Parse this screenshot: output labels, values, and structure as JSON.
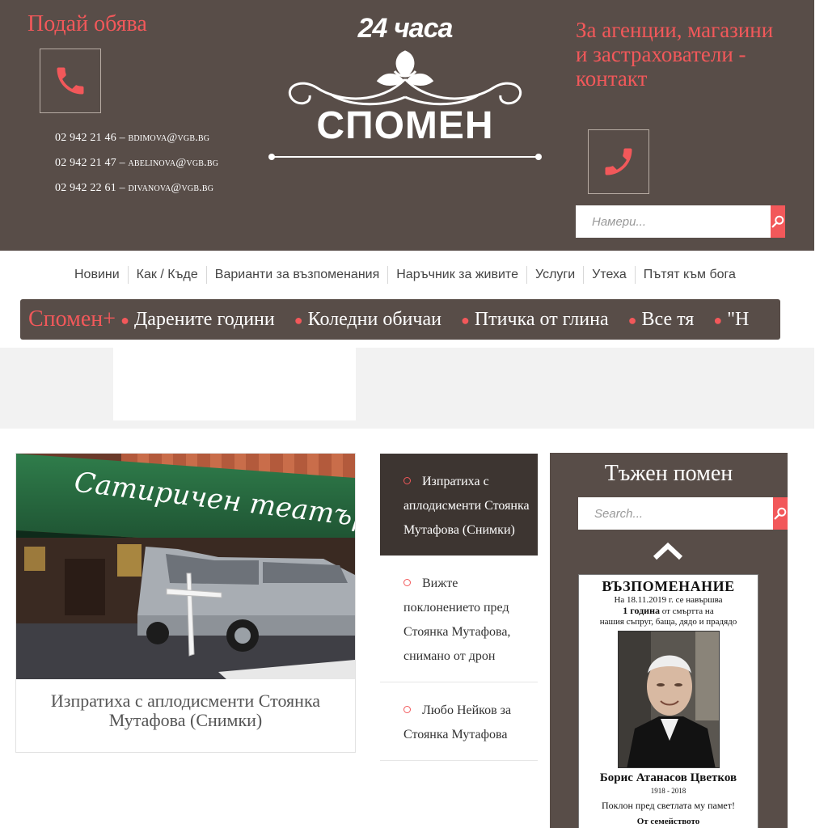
{
  "header": {
    "post_ad": "Подай обява",
    "contacts": [
      {
        "phone": "02 942 21 46",
        "email": "bdimova@vgb.bg"
      },
      {
        "phone": "02 942 21 47",
        "email": "abelinova@vgb.bg"
      },
      {
        "phone": "02 942 22 61",
        "email": "divanova@vgb.bg"
      }
    ],
    "logo_brand": "24 часа",
    "logo_name": "СПОМЕН",
    "agency_contact": "За агенции, магазини и застрахователи - контакт",
    "search_placeholder": "Намери..."
  },
  "nav": {
    "items": [
      "Новини",
      "Как / Къде",
      "Варианти за възпоменания",
      "Наръчник за живите",
      "Услуги",
      "Утеха",
      "Пътят към бога"
    ]
  },
  "ticker": {
    "label": "Спомен+",
    "items": [
      "Дарените години",
      "Коледни обичаи",
      "Птичка от глина",
      "Все тя",
      "\"Н"
    ]
  },
  "main_article": {
    "title": "Изпратиха с аплодисменти Стоянка Мутафова (Снимки)",
    "photo_sign": "Сатиричен театър"
  },
  "news_list": [
    {
      "title": "Изпратиха с аплодисменти Стоянка Мутафова (Снимки)",
      "active": true
    },
    {
      "title": "Вижте поклонението пред Стоянка Мутафова, снимано от дрон",
      "active": false
    },
    {
      "title": "Любо Нейков за Стоянка Мутафова",
      "active": false
    }
  ],
  "sidebar": {
    "title": "Тъжен помен",
    "search_placeholder": "Search...",
    "memorial": {
      "heading": "ВЪЗПОМЕНАНИЕ",
      "line1": "На 18.11.2019 г. се навършва",
      "line2_bold": "1 година",
      "line2_rest": " от смъртта на",
      "line3": "нашия съпруг, баща, дядо и прадядо",
      "name": "Борис Атанасов Цветков",
      "years": "1918 - 2018",
      "tribute": "Поклон пред светлата му памет!",
      "family": "От семейството"
    }
  },
  "colors": {
    "header_bg": "#584d48",
    "accent": "#f2585a",
    "active_item_bg": "#3d3531"
  }
}
